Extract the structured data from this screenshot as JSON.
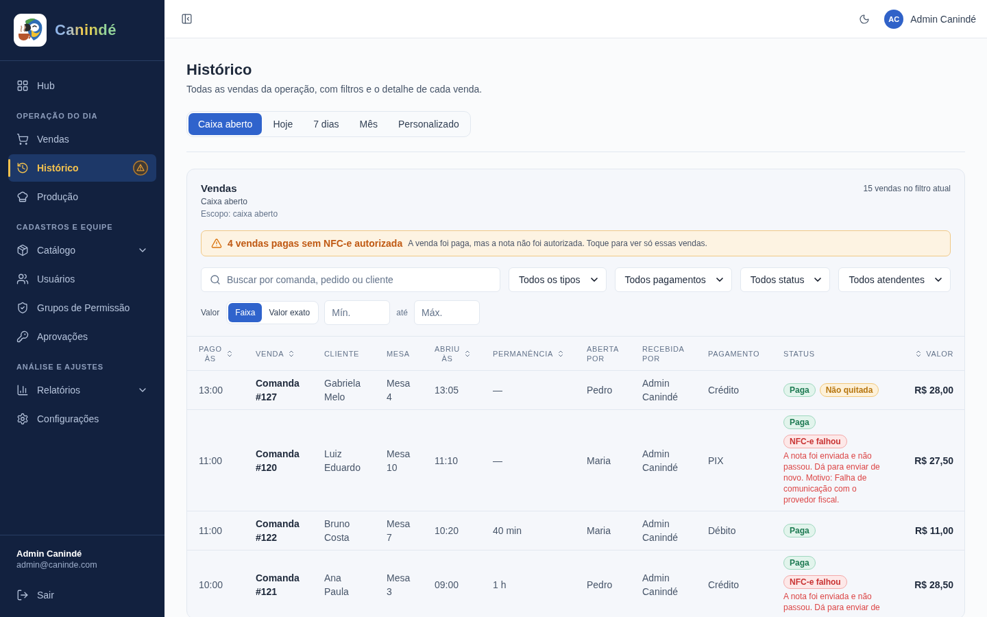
{
  "sidebar": {
    "brand": "Canindé",
    "nav": [
      {
        "kind": "link",
        "label": "Hub",
        "selected": false,
        "alert": false
      },
      {
        "kind": "section",
        "label": "OPERAÇÃO DO DIA"
      },
      {
        "kind": "link",
        "label": "Vendas",
        "selected": false,
        "alert": false
      },
      {
        "kind": "link",
        "label": "Histórico",
        "selected": true,
        "alert": true
      },
      {
        "kind": "link",
        "label": "Produção",
        "selected": false,
        "alert": false
      },
      {
        "kind": "section",
        "label": "CADASTROS E EQUIPE"
      },
      {
        "kind": "group",
        "label": "Catálogo",
        "selected": false,
        "alert": false,
        "expanded": false
      },
      {
        "kind": "link",
        "label": "Usuários",
        "selected": false,
        "alert": false
      },
      {
        "kind": "link",
        "label": "Grupos de Permissão",
        "selected": false,
        "alert": false
      },
      {
        "kind": "link",
        "label": "Aprovações",
        "selected": false,
        "alert": false
      },
      {
        "kind": "section",
        "label": "ANÁLISE E AJUSTES"
      },
      {
        "kind": "group",
        "label": "Relatórios",
        "selected": false,
        "alert": false,
        "expanded": false
      },
      {
        "kind": "link",
        "label": "Configurações",
        "selected": false,
        "alert": false
      }
    ],
    "user": {
      "name": "Admin Canindé",
      "email": "admin@caninde.com"
    },
    "logout": "Sair"
  },
  "top_bar": {
    "avatar": "AC",
    "user_name": "Admin Canindé"
  },
  "page": {
    "title": "Histórico",
    "subtitle": "Todas as vendas da operação, com filtros e o detalhe de cada venda."
  },
  "period_tabs": [
    {
      "label": "Caixa aberto",
      "selected": true
    },
    {
      "label": "Hoje",
      "selected": false
    },
    {
      "label": "7 dias",
      "selected": false
    },
    {
      "label": "Mês",
      "selected": false
    },
    {
      "label": "Personalizado",
      "selected": false
    }
  ],
  "sales": {
    "title": "Vendas",
    "subtitle": "Caixa aberto",
    "scope": "Escopo: caixa aberto",
    "count": "15 vendas no filtro atual",
    "alert": {
      "title": "4 vendas pagas sem NFC-e autorizada",
      "message": "A venda foi paga, mas a nota não foi autorizada. Toque para ver só essas vendas."
    },
    "search": {
      "placeholder": "Buscar por comanda, pedido ou cliente"
    },
    "selects": [
      "Todos os tipos",
      "Todos pagamentos",
      "Todos status",
      "Todos atendentes"
    ],
    "value_filter": {
      "label": "Valor",
      "modes": [
        {
          "label": "Faixa",
          "selected": true
        },
        {
          "label": "Valor exato",
          "selected": false
        }
      ],
      "min": {
        "placeholder": "Mín."
      },
      "separator": "até",
      "max": {
        "placeholder": "Máx."
      }
    },
    "table": {
      "columns": [
        {
          "label": "PAGO ÀS",
          "sortable": true
        },
        {
          "label": "VENDA",
          "sortable": true
        },
        {
          "label": "CLIENTE",
          "sortable": false
        },
        {
          "label": "MESA",
          "sortable": false
        },
        {
          "label": "ABRIU ÀS",
          "sortable": true
        },
        {
          "label": "PERMANÊNCIA",
          "sortable": true
        },
        {
          "label": "ABERTA POR",
          "sortable": false
        },
        {
          "label": "RECEBIDA POR",
          "sortable": false
        },
        {
          "label": "PAGAMENTO",
          "sortable": false
        },
        {
          "label": "STATUS",
          "sortable": false
        },
        {
          "label": "VALOR",
          "sortable": true
        }
      ],
      "rows": [
        {
          "paid_at": "13:00",
          "sale": "Comanda #127",
          "client": "Gabriela Melo",
          "table": "Mesa 4",
          "opened_at": "13:05",
          "duration": "—",
          "opened_by": "Pedro",
          "received_by": "Admin Canindé",
          "payment": "Crédito",
          "badges": [
            {
              "label": "Paga",
              "kind": "paid"
            },
            {
              "label": "Não quitada",
              "kind": "pending"
            }
          ],
          "value": "R$ 28,00"
        },
        {
          "paid_at": "11:00",
          "sale": "Comanda #120",
          "client": "Luiz Eduardo",
          "table": "Mesa 10",
          "opened_at": "11:10",
          "duration": "—",
          "opened_by": "Maria",
          "received_by": "Admin Canindé",
          "payment": "PIX",
          "badges": [
            {
              "label": "Paga",
              "kind": "paid"
            }
          ],
          "nfce": {
            "label": "NFC-e falhou",
            "kind": "failed",
            "message": "A nota foi enviada e não passou. Dá para enviar de novo. Motivo: Falha de comunicação com o provedor fiscal."
          },
          "value": "R$ 27,50"
        },
        {
          "paid_at": "11:00",
          "sale": "Comanda #122",
          "client": "Bruno Costa",
          "table": "Mesa 7",
          "opened_at": "10:20",
          "duration": "40 min",
          "opened_by": "Maria",
          "received_by": "Admin Canindé",
          "payment": "Débito",
          "badges": [
            {
              "label": "Paga",
              "kind": "paid"
            }
          ],
          "value": "R$ 11,00"
        },
        {
          "paid_at": "10:00",
          "sale": "Comanda #121",
          "client": "Ana Paula",
          "table": "Mesa 3",
          "opened_at": "09:00",
          "duration": "1 h",
          "opened_by": "Pedro",
          "received_by": "Admin Canindé",
          "payment": "Crédito",
          "badges": [
            {
              "label": "Paga",
              "kind": "paid"
            }
          ],
          "nfce": {
            "label": "NFC-e falhou",
            "kind": "failed",
            "message": "A nota foi enviada e não passou. Dá para enviar de"
          },
          "value": "R$ 28,50"
        }
      ]
    }
  }
}
